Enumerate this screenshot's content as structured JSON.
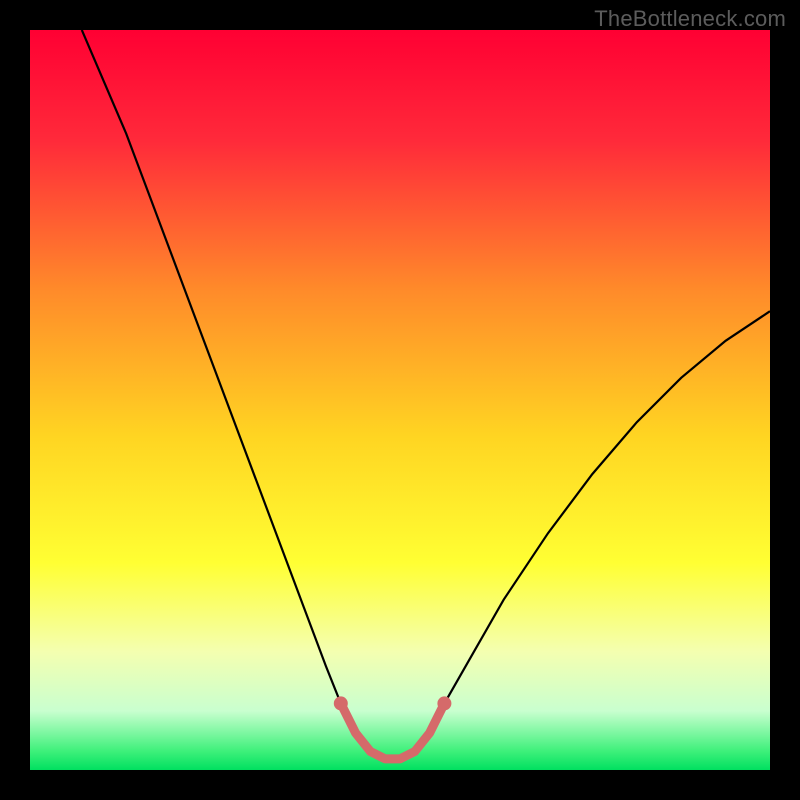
{
  "watermark": "TheBottleneck.com",
  "chart_data": {
    "type": "line",
    "title": "",
    "xlabel": "",
    "ylabel": "",
    "xlim": [
      0,
      100
    ],
    "ylim": [
      0,
      100
    ],
    "grid": false,
    "legend": false,
    "background": {
      "kind": "vertical-gradient",
      "stops": [
        {
          "pos": 0.0,
          "color": "#ff0033"
        },
        {
          "pos": 0.15,
          "color": "#ff2a3a"
        },
        {
          "pos": 0.35,
          "color": "#ff8a2a"
        },
        {
          "pos": 0.55,
          "color": "#ffd522"
        },
        {
          "pos": 0.72,
          "color": "#ffff33"
        },
        {
          "pos": 0.84,
          "color": "#f4ffb0"
        },
        {
          "pos": 0.92,
          "color": "#c9ffcf"
        },
        {
          "pos": 0.975,
          "color": "#3df07a"
        },
        {
          "pos": 1.0,
          "color": "#00e060"
        }
      ]
    },
    "series": [
      {
        "name": "bottleneck-curve",
        "color": "#000000",
        "x": [
          7,
          10,
          13,
          16,
          19,
          22,
          25,
          28,
          31,
          34,
          37,
          40,
          42,
          44,
          46,
          48,
          50,
          52,
          54,
          56,
          60,
          64,
          70,
          76,
          82,
          88,
          94,
          100
        ],
        "y": [
          100,
          93,
          86,
          78,
          70,
          62,
          54,
          46,
          38,
          30,
          22,
          14,
          9,
          5,
          2.5,
          1.5,
          1.5,
          2.5,
          5,
          9,
          16,
          23,
          32,
          40,
          47,
          53,
          58,
          62
        ]
      },
      {
        "name": "bottleneck-highlight",
        "color": "#d56a6a",
        "stroke_width": 9,
        "linecap": "round",
        "x": [
          42,
          44,
          46,
          48,
          50,
          52,
          54,
          56
        ],
        "y": [
          9,
          5,
          2.5,
          1.5,
          1.5,
          2.5,
          5,
          9
        ]
      },
      {
        "name": "marker-left",
        "type": "scatter",
        "color": "#d56a6a",
        "x": [
          42
        ],
        "y": [
          9
        ],
        "size": 7
      },
      {
        "name": "marker-right",
        "type": "scatter",
        "color": "#d56a6a",
        "x": [
          56
        ],
        "y": [
          9
        ],
        "size": 7
      }
    ]
  }
}
